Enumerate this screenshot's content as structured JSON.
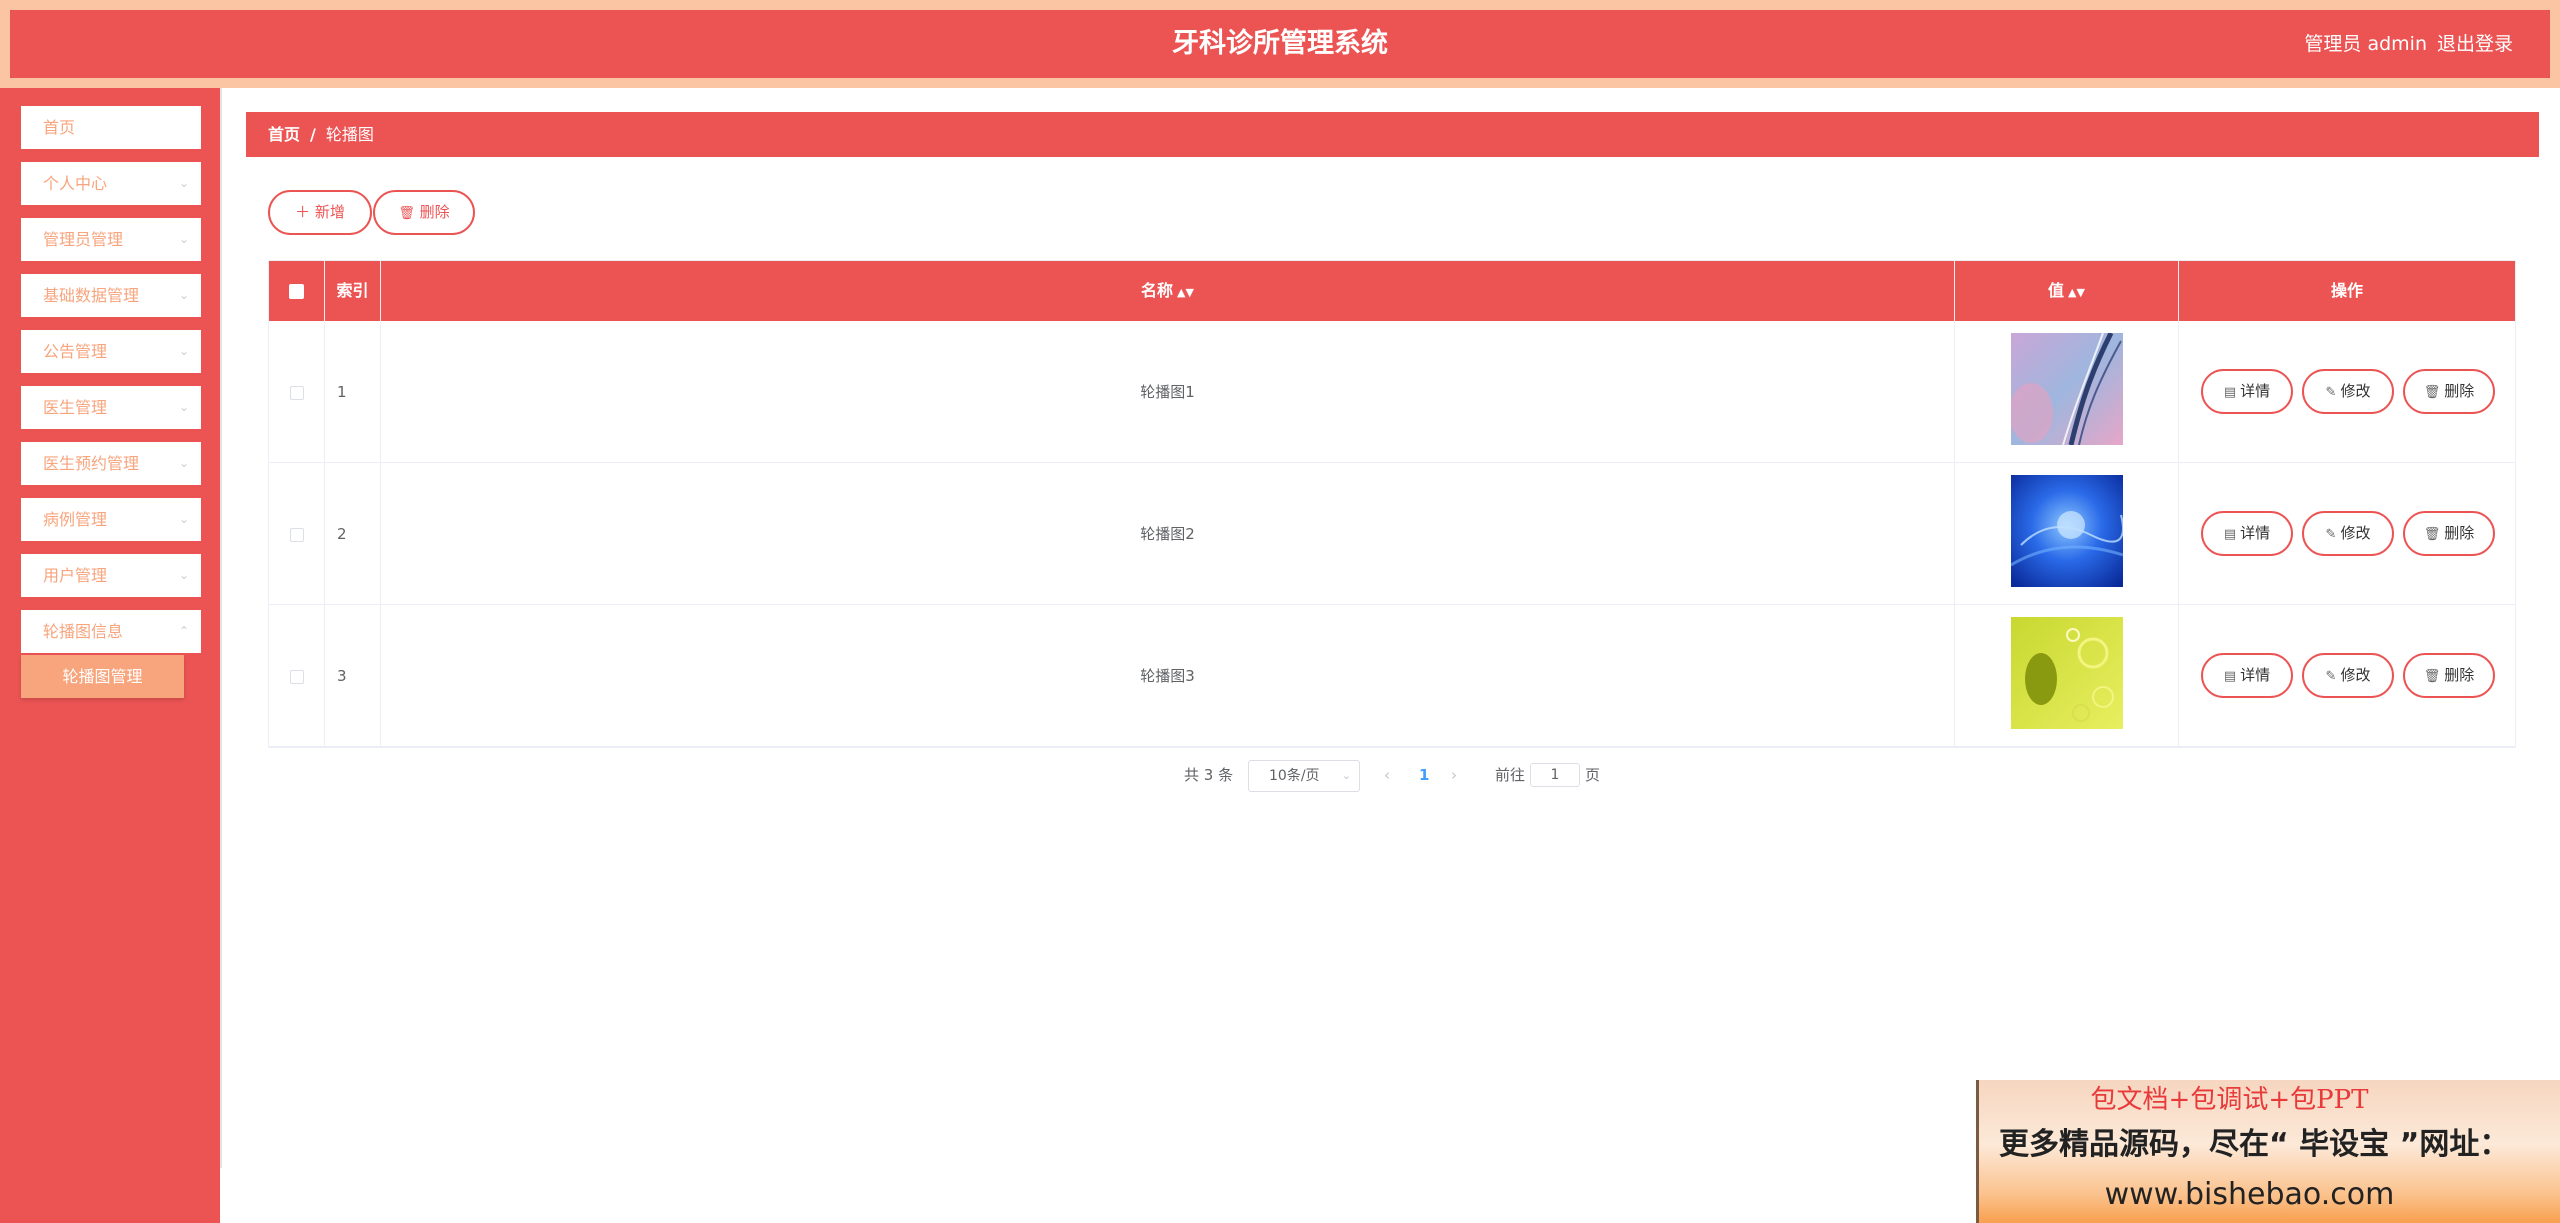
{
  "header": {
    "title": "牙科诊所管理系统",
    "user": "管理员 admin",
    "logout": "退出登录"
  },
  "sidebar": {
    "items": [
      {
        "label": "首页"
      },
      {
        "label": "个人中心"
      },
      {
        "label": "管理员管理"
      },
      {
        "label": "基础数据管理"
      },
      {
        "label": "公告管理"
      },
      {
        "label": "医生管理"
      },
      {
        "label": "医生预约管理"
      },
      {
        "label": "病例管理"
      },
      {
        "label": "用户管理"
      },
      {
        "label": "轮播图信息"
      }
    ],
    "active_sub": "轮播图管理"
  },
  "breadcrumb": {
    "home": "首页",
    "separator": "/",
    "current": "轮播图"
  },
  "toolbar": {
    "add_label": "新增",
    "delete_label": "删除"
  },
  "table": {
    "columns": {
      "index": "索引",
      "name": "名称",
      "value": "值",
      "actions": "操作"
    },
    "rows": [
      {
        "index": "1",
        "name": "轮播图1",
        "image": "abstract-pink-blue-lines"
      },
      {
        "index": "2",
        "name": "轮播图2",
        "image": "blue-light-abstract"
      },
      {
        "index": "3",
        "name": "轮播图3",
        "image": "yellow-green-bubbles"
      }
    ],
    "actions": {
      "detail": "详情",
      "edit": "修改",
      "delete": "删除"
    }
  },
  "pagination": {
    "total": "共 3 条",
    "page_size": "10条/页",
    "current_page": "1",
    "goto_prefix": "前往",
    "goto_value": "1",
    "goto_suffix": "页"
  },
  "banner": {
    "line1": "包文档+包调试+包PPT",
    "line2": "更多精品源码，尽在“ 毕设宝 ”网址：",
    "line3": "www.bishebao.com"
  },
  "colors": {
    "primary": "#ec5454",
    "accent": "#f8a47c",
    "header_border": "#fbc4a3"
  }
}
